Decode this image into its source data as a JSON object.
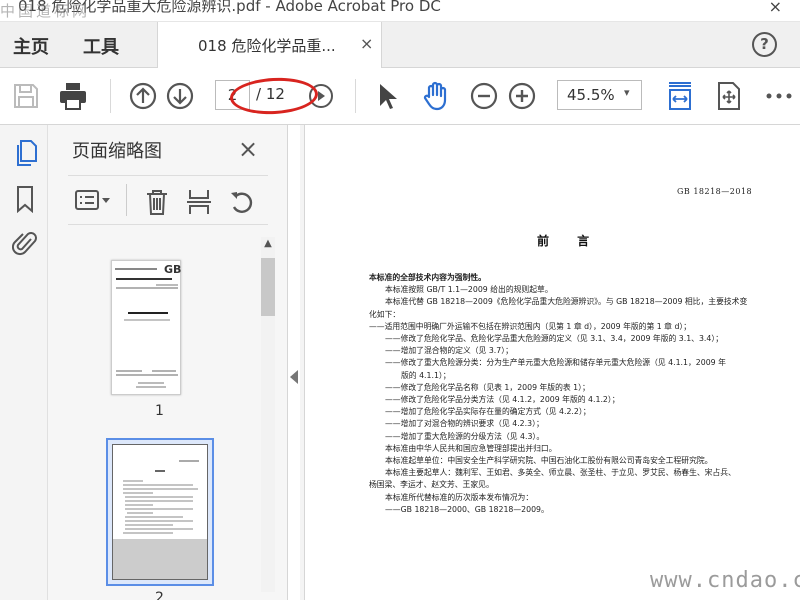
{
  "window": {
    "title": "018 危险化学品重大危险源辨识.pdf - Adobe Acrobat Pro DC",
    "close_glyph": "×"
  },
  "tabs": {
    "home": "主页",
    "tools": "工具",
    "document": "018 危险化学品重...",
    "document_close": "×",
    "help": "?"
  },
  "toolbar": {
    "page_current": "2",
    "page_total": "/ 12",
    "zoom": "45.5%",
    "zoom_caret": "▾",
    "icons": [
      "save-icon",
      "print-icon",
      "prev-page-icon",
      "next-page-icon",
      "play-icon",
      "select-cursor-icon",
      "hand-tool-icon",
      "zoom-out-icon",
      "zoom-in-icon",
      "fit-page-icon",
      "page-display-icon",
      "more-icon"
    ]
  },
  "accent_colors": {
    "acrobat_blue": "#2d6fd1",
    "annotation_red": "#d8241f",
    "selection_blue": "#5b8ee6"
  },
  "sidebar": {
    "icons": [
      "pages-icon",
      "bookmark-icon",
      "attachment-icon"
    ]
  },
  "thumbnails_panel": {
    "title": "页面缩略图",
    "close": "×",
    "tools": [
      "options-menu-icon",
      "delete-icon",
      "extract-icon",
      "rotate-icon"
    ],
    "pages": [
      {
        "label": "1"
      },
      {
        "label": "2"
      }
    ]
  },
  "document": {
    "code": "GB 18218—2018",
    "heading": "前 言",
    "lines": [
      {
        "text": "本标准的全部技术内容为强制性。",
        "style": "b"
      },
      {
        "text": "本标准按照 GB/T 1.1—2009 给出的规则起草。",
        "style": "i1"
      },
      {
        "text": "本标准代替 GB 18218—2009《危险化学品重大危险源辨识》。与 GB 18218—2009 相比，主要技术变",
        "style": "i1"
      },
      {
        "text": "化如下：",
        "style": "i2"
      },
      {
        "text": "——适用范围中明确厂外运输不包括在辨识范围内（见第 1 章 d），2009 年版的第 1 章 d）；",
        "style": "i2"
      },
      {
        "text": "——修改了危险化学品、危险化学品重大危险源的定义（见 3.1、3.4，2009 年版的 3.1、3.4）；",
        "style": "i1"
      },
      {
        "text": "——增加了混合物的定义（见 3.7）；",
        "style": "i1"
      },
      {
        "text": "——修改了重大危险源分类：分为生产单元重大危险源和储存单元重大危险源（见 4.1.1，2009 年",
        "style": "i1"
      },
      {
        "text": "版的 4.1.1）；",
        "style": "wrap"
      },
      {
        "text": "——修改了危险化学品名称（见表 1，2009 年版的表 1）；",
        "style": "i1"
      },
      {
        "text": "——修改了危险化学品分类方法（见 4.1.2，2009 年版的 4.1.2）；",
        "style": "i1"
      },
      {
        "text": "——增加了危险化学品实际存在量的确定方式（见 4.2.2）；",
        "style": "i1"
      },
      {
        "text": "——增加了对混合物的辨识要求（见 4.2.3）；",
        "style": "i1"
      },
      {
        "text": "——增加了重大危险源的分级方法（见 4.3）。",
        "style": "i1"
      },
      {
        "text": "本标准由中华人民共和国应急管理部提出并归口。",
        "style": "i1"
      },
      {
        "text": "本标准起草单位：中国安全生产科学研究院、中国石油化工股份有限公司青岛安全工程研究院。",
        "style": "i1"
      },
      {
        "text": "本标准主要起草人：魏利军、王如君、多英全、师立晨、张圣柱、于立见、罗艾民、杨春生、宋占兵、",
        "style": "i1"
      },
      {
        "text": "杨国梁、李运才、赵文芳、王家见。",
        "style": "i2"
      },
      {
        "text": "本标准所代替标准的历次版本发布情况为：",
        "style": "i1"
      },
      {
        "text": "——GB 18218—2000、GB 18218—2009。",
        "style": "i1"
      }
    ]
  },
  "watermarks": {
    "top_left": "中国道标网",
    "bottom_right": "www.cndao.com"
  }
}
